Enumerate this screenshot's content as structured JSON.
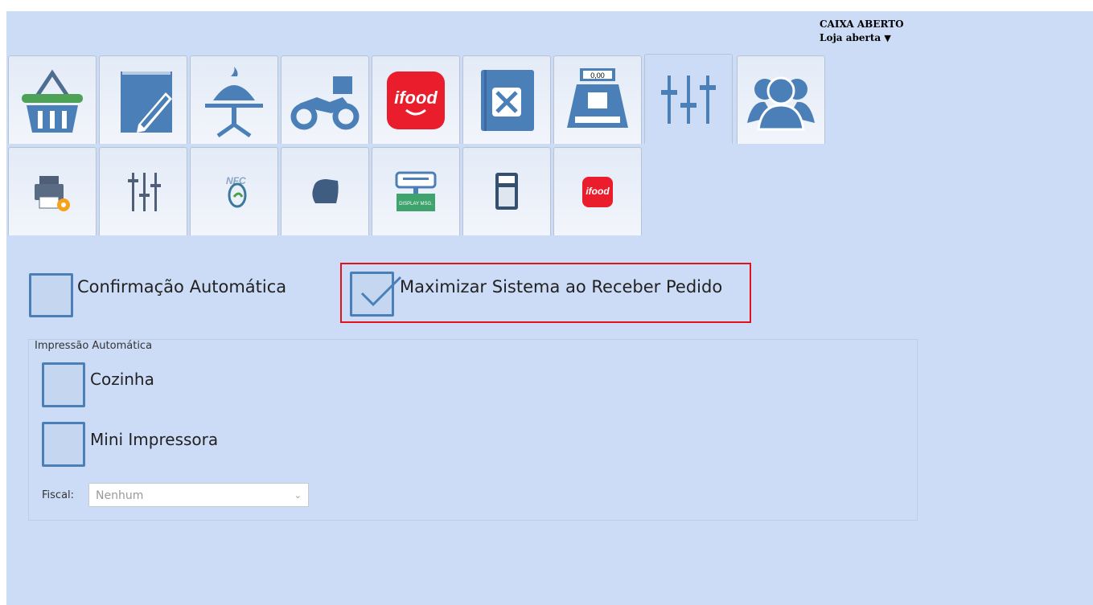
{
  "status": {
    "caixa": "CAIXA ABERTO",
    "loja": "Loja aberta",
    "loja_caret": "▼"
  },
  "tabs_row1": [
    {
      "name": "basket-icon"
    },
    {
      "name": "notepad-pencil-icon"
    },
    {
      "name": "cloche-table-icon"
    },
    {
      "name": "delivery-motorcycle-icon"
    },
    {
      "name": "ifood-logo-icon",
      "text": "ifood"
    },
    {
      "name": "menu-book-icon"
    },
    {
      "name": "cash-register-icon",
      "text": "0,00"
    },
    {
      "name": "settings-sliders-icon"
    },
    {
      "name": "users-icon"
    }
  ],
  "tabs_row2": [
    {
      "name": "printer-settings-icon"
    },
    {
      "name": "sliders-icon"
    },
    {
      "name": "nfce-icon",
      "text": "NFC"
    },
    {
      "name": "thermal-printer-icon"
    },
    {
      "name": "display-message-icon",
      "text": "DISPLAY MSG."
    },
    {
      "name": "calculator-icon"
    },
    {
      "name": "ifood-small-logo-icon",
      "text": "ifood"
    }
  ],
  "options": {
    "confirmacao": {
      "label": "Confirmação Automática",
      "checked": false
    },
    "maximizar": {
      "label": "Maximizar Sistema ao Receber Pedido",
      "checked": true
    }
  },
  "impressao": {
    "title": "Impressão Automática",
    "cozinha": {
      "label": "Cozinha",
      "checked": false
    },
    "mini": {
      "label": "Mini Impressora",
      "checked": false
    }
  },
  "fiscal": {
    "label": "Fiscal:",
    "value": "Nenhum"
  },
  "colors": {
    "background": "#ccdcf6",
    "icon_blue": "#4b7fb8",
    "ifood_red": "#ea1d2c",
    "highlight": "#e2121b"
  }
}
